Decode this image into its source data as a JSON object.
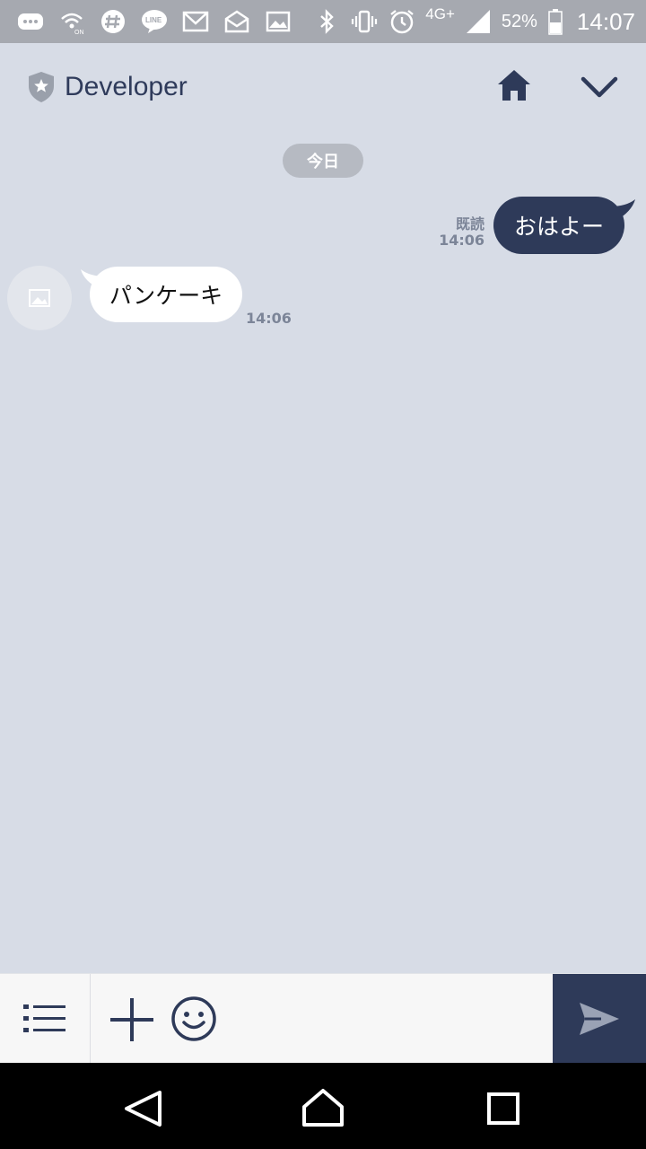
{
  "status_bar": {
    "network_label": "4G+",
    "battery_percent": "52%",
    "clock": "14:07",
    "icons": [
      "chat-bubble-icon",
      "wifi-calling-icon",
      "slack-icon",
      "line-icon",
      "gmail-icon",
      "mail-open-icon",
      "gallery-icon",
      "bluetooth-icon",
      "vibrate-icon",
      "alarm-icon",
      "signal-icon",
      "battery-icon"
    ]
  },
  "header": {
    "title": "Developer",
    "icons": [
      "shield-icon",
      "home-icon",
      "chevron-down-icon"
    ]
  },
  "chat": {
    "date_label": "今日",
    "messages": [
      {
        "direction": "outgoing",
        "text": "おはよー",
        "read_label": "既読",
        "time": "14:06"
      },
      {
        "direction": "incoming",
        "text": "パンケーキ",
        "time": "14:06"
      }
    ]
  },
  "input_bar": {
    "value": "",
    "icons": [
      "menu-list-icon",
      "plus-icon",
      "smile-icon",
      "send-icon"
    ]
  },
  "colors": {
    "background": "#d7dce6",
    "accent_dark": "#2e3a59",
    "incoming_bubble": "#ffffff",
    "status_bar": "#a6a9b0"
  }
}
